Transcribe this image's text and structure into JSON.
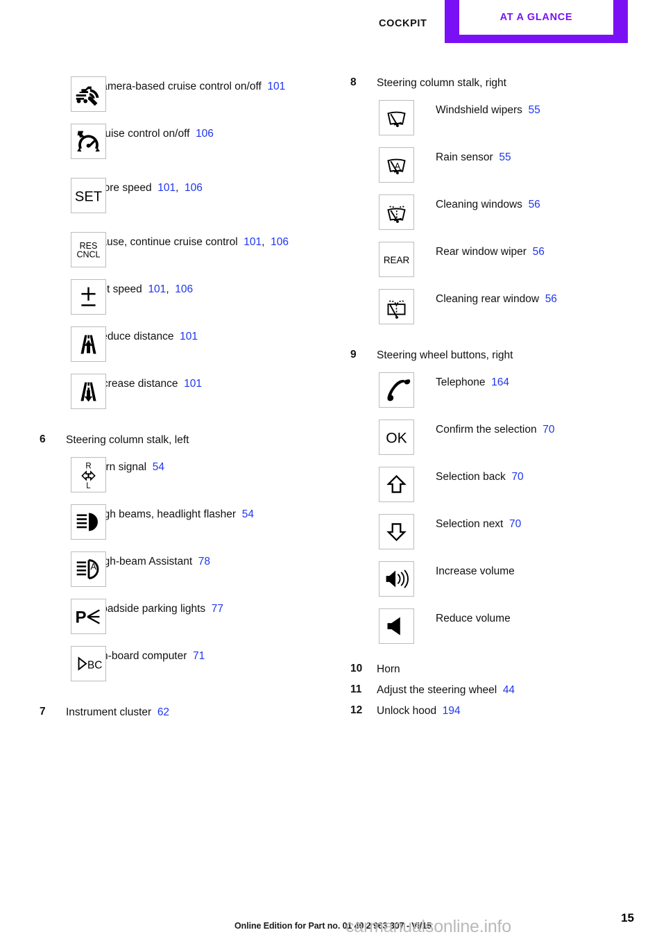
{
  "header": {
    "chapter": "COCKPIT",
    "tab": "AT A GLANCE",
    "accent_color": "#7a11f5"
  },
  "reference_color": "#1e35f0",
  "left_column": {
    "items": [
      {
        "icon": "camera-cruise-control-icon",
        "label": "Camera-based cruise control on/off",
        "refs": [
          "101"
        ]
      },
      {
        "icon": "cruise-control-icon",
        "label": "Cruise control on/off",
        "refs": [
          "106"
        ]
      },
      {
        "icon": "set-icon",
        "label": "Store speed",
        "refs": [
          "101",
          "106"
        ]
      },
      {
        "icon": "res-cncl-icon",
        "label": "Pause, continue cruise control",
        "refs": [
          "101",
          "106"
        ]
      },
      {
        "icon": "plus-minus-icon",
        "label": "Set speed",
        "refs": [
          "101",
          "106"
        ]
      },
      {
        "icon": "reduce-distance-icon",
        "label": "Reduce distance",
        "refs": [
          "101"
        ]
      },
      {
        "icon": "increase-distance-icon",
        "label": "Increase distance",
        "refs": [
          "101"
        ]
      }
    ],
    "section6": {
      "number": "6",
      "title": "Steering column stalk, left",
      "items": [
        {
          "icon": "turn-signal-icon",
          "label": "Turn signal",
          "refs": [
            "54"
          ]
        },
        {
          "icon": "high-beam-icon",
          "label": "High beams, headlight flasher",
          "refs": [
            "54"
          ]
        },
        {
          "icon": "high-beam-assistant-icon",
          "label": "High-beam Assistant",
          "refs": [
            "78"
          ]
        },
        {
          "icon": "parking-lights-icon",
          "label": "Roadside parking lights",
          "refs": [
            "77"
          ]
        },
        {
          "icon": "on-board-computer-icon",
          "label": "On-board computer",
          "refs": [
            "71"
          ]
        }
      ]
    },
    "section7": {
      "number": "7",
      "title": "Instrument cluster",
      "refs": [
        "62"
      ]
    }
  },
  "right_column": {
    "section8": {
      "number": "8",
      "title": "Steering column stalk, right",
      "items": [
        {
          "icon": "windshield-wiper-icon",
          "label": "Windshield wipers",
          "refs": [
            "55"
          ]
        },
        {
          "icon": "rain-sensor-icon",
          "label": "Rain sensor",
          "refs": [
            "55"
          ]
        },
        {
          "icon": "cleaning-windows-icon",
          "label": "Cleaning windows",
          "refs": [
            "56"
          ]
        },
        {
          "icon": "rear-wiper-icon",
          "label": "Rear window wiper",
          "refs": [
            "56"
          ]
        },
        {
          "icon": "cleaning-rear-window-icon",
          "label": "Cleaning rear window",
          "refs": [
            "56"
          ]
        }
      ]
    },
    "section9": {
      "number": "9",
      "title": "Steering wheel buttons, right",
      "items": [
        {
          "icon": "telephone-icon",
          "label": "Telephone",
          "refs": [
            "164"
          ]
        },
        {
          "icon": "ok-icon",
          "label": "Confirm the selection",
          "refs": [
            "70"
          ]
        },
        {
          "icon": "arrow-up-icon",
          "label": "Selection back",
          "refs": [
            "70"
          ]
        },
        {
          "icon": "arrow-down-icon",
          "label": "Selection next",
          "refs": [
            "70"
          ]
        },
        {
          "icon": "volume-up-icon",
          "label": "Increase volume",
          "refs": []
        },
        {
          "icon": "volume-down-icon",
          "label": "Reduce volume",
          "refs": []
        }
      ]
    },
    "plain_items": [
      {
        "number": "10",
        "label": "Horn",
        "refs": []
      },
      {
        "number": "11",
        "label": "Adjust the steering wheel",
        "refs": [
          "44"
        ]
      },
      {
        "number": "12",
        "label": "Unlock hood",
        "refs": [
          "194"
        ]
      }
    ]
  },
  "icon_text": {
    "set": "SET",
    "res": "RES",
    "cncl": "CNCL",
    "turn_r": "R",
    "turn_l": "L",
    "bc": "BC",
    "rear": "REAR",
    "ok": "OK",
    "rain_a": "A",
    "hba_a": "A",
    "park_p": "P"
  },
  "footer": {
    "edition": "Online Edition for Part no. 01 40 2 963 307 - VI/15",
    "page": "15",
    "watermark": "carmanualsonline.info"
  }
}
